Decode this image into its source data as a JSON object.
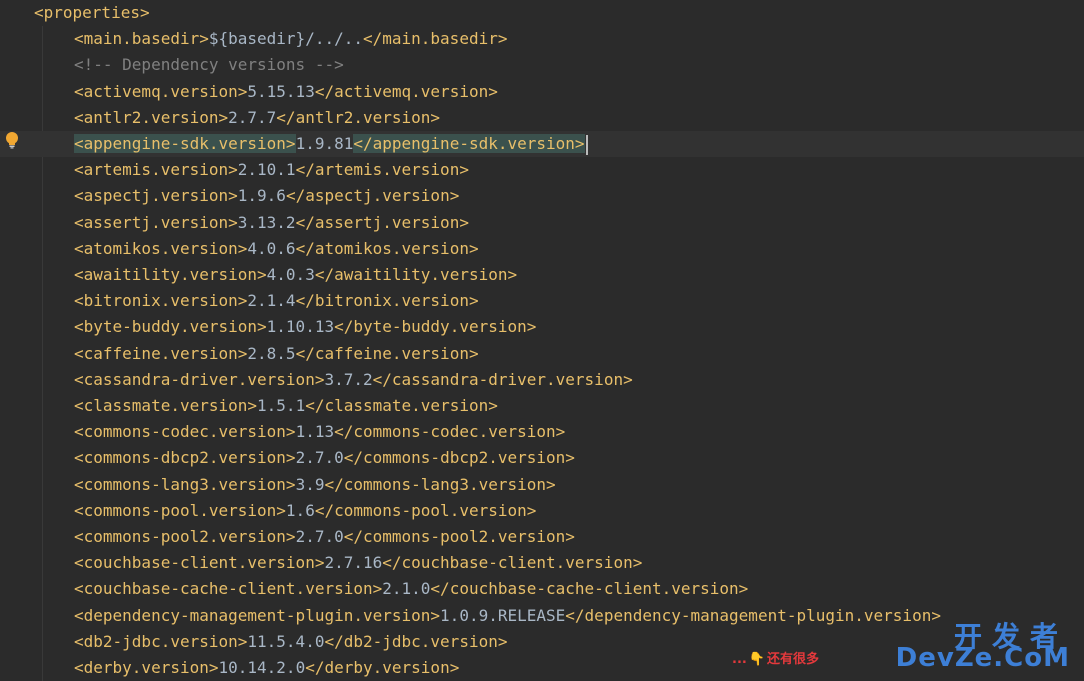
{
  "editor": {
    "lines": [
      {
        "open": "<properties>",
        "value": "",
        "close": "",
        "indent": false
      },
      {
        "open": "<main.basedir>",
        "value": "${basedir}/../..",
        "close": "</main.basedir>",
        "indent": true
      },
      {
        "comment": "<!-- Dependency versions -->",
        "indent": true
      },
      {
        "open": "<activemq.version>",
        "value": "5.15.13",
        "close": "</activemq.version>",
        "indent": true
      },
      {
        "open": "<antlr2.version>",
        "value": "2.7.7",
        "close": "</antlr2.version>",
        "indent": true
      },
      {
        "open": "<appengine-sdk.version>",
        "value": "1.9.81",
        "close": "</appengine-sdk.version>",
        "indent": true,
        "current": true
      },
      {
        "open": "<artemis.version>",
        "value": "2.10.1",
        "close": "</artemis.version>",
        "indent": true
      },
      {
        "open": "<aspectj.version>",
        "value": "1.9.6",
        "close": "</aspectj.version>",
        "indent": true
      },
      {
        "open": "<assertj.version>",
        "value": "3.13.2",
        "close": "</assertj.version>",
        "indent": true
      },
      {
        "open": "<atomikos.version>",
        "value": "4.0.6",
        "close": "</atomikos.version>",
        "indent": true
      },
      {
        "open": "<awaitility.version>",
        "value": "4.0.3",
        "close": "</awaitility.version>",
        "indent": true
      },
      {
        "open": "<bitronix.version>",
        "value": "2.1.4",
        "close": "</bitronix.version>",
        "indent": true
      },
      {
        "open": "<byte-buddy.version>",
        "value": "1.10.13",
        "close": "</byte-buddy.version>",
        "indent": true
      },
      {
        "open": "<caffeine.version>",
        "value": "2.8.5",
        "close": "</caffeine.version>",
        "indent": true
      },
      {
        "open": "<cassandra-driver.version>",
        "value": "3.7.2",
        "close": "</cassandra-driver.version>",
        "indent": true
      },
      {
        "open": "<classmate.version>",
        "value": "1.5.1",
        "close": "</classmate.version>",
        "indent": true
      },
      {
        "open": "<commons-codec.version>",
        "value": "1.13",
        "close": "</commons-codec.version>",
        "indent": true
      },
      {
        "open": "<commons-dbcp2.version>",
        "value": "2.7.0",
        "close": "</commons-dbcp2.version>",
        "indent": true
      },
      {
        "open": "<commons-lang3.version>",
        "value": "3.9",
        "close": "</commons-lang3.version>",
        "indent": true
      },
      {
        "open": "<commons-pool.version>",
        "value": "1.6",
        "close": "</commons-pool.version>",
        "indent": true
      },
      {
        "open": "<commons-pool2.version>",
        "value": "2.7.0",
        "close": "</commons-pool2.version>",
        "indent": true
      },
      {
        "open": "<couchbase-client.version>",
        "value": "2.7.16",
        "close": "</couchbase-client.version>",
        "indent": true
      },
      {
        "open": "<couchbase-cache-client.version>",
        "value": "2.1.0",
        "close": "</couchbase-cache-client.version>",
        "indent": true
      },
      {
        "open": "<dependency-management-plugin.version>",
        "value": "1.0.9.RELEASE",
        "close": "</dependency-management-plugin.version>",
        "indent": true
      },
      {
        "open": "<db2-jdbc.version>",
        "value": "11.5.4.0",
        "close": "</db2-jdbc.version>",
        "indent": true
      },
      {
        "open": "<derby.version>",
        "value": "10.14.2.0",
        "close": "</derby.version>",
        "indent": true
      }
    ]
  },
  "more_badge": {
    "dots": "...",
    "hand": "👇",
    "text": "还有很多"
  },
  "watermark": {
    "top": "开发者",
    "bottom": "DevZe.CoM"
  },
  "colors": {
    "background": "#2b2b2b",
    "tag": "#e8bf6a",
    "text": "#a9b7c6",
    "comment": "#808080",
    "current_line": "#323232",
    "match_highlight": "#3b514d",
    "watermark": "#3d7fd6"
  }
}
